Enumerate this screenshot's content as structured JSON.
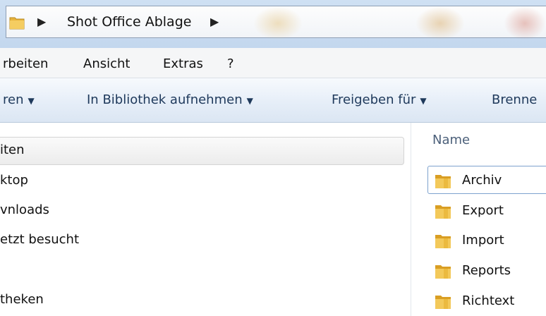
{
  "address_bar": {
    "folder_icon": "folder-icon",
    "path": [
      "Shot Office Ablage"
    ]
  },
  "menu": {
    "items": [
      "rbeiten",
      "Ansicht",
      "Extras",
      "?"
    ]
  },
  "toolbar": {
    "items": [
      "ren",
      "In Bibliothek aufnehmen",
      "Freigeben für",
      "Brenne"
    ]
  },
  "nav_pane": {
    "items": [
      "iten",
      "ktop",
      "vnloads",
      "etzt besucht",
      "theken"
    ],
    "selected_index": 0
  },
  "content": {
    "column_header": "Name",
    "files": [
      "Archiv",
      "Export",
      "Import",
      "Reports",
      "Richtext"
    ],
    "focused_index": 0
  },
  "colors": {
    "toolbar_text": "#1e395b",
    "folder": "#e8b33c"
  }
}
